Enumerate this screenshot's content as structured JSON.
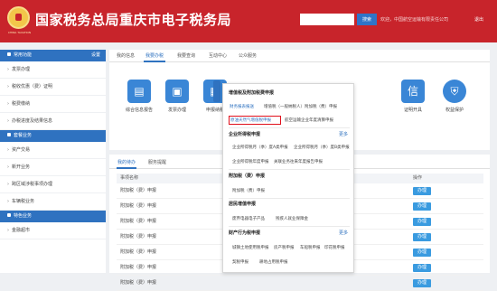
{
  "header": {
    "title": "国家税务总局重庆市电子税务局",
    "emblem_text": "CHINA TAXATION",
    "search_button": "搜索",
    "user_info": "欢迎，中国航空运输有限责任公司",
    "logout": "退出"
  },
  "sidebar": {
    "sections": [
      {
        "title": "常用功能",
        "right": "设置",
        "items": [
          "发票办理",
          "税收优惠（费）证明",
          "税费缴纳",
          "办税进度及结果信息"
        ]
      },
      {
        "title": "套餐业务",
        "items": [
          "资产交易",
          "新开业务",
          "跨区域涉税事项办理",
          "车辆税业务"
        ]
      },
      {
        "title": "特色业务",
        "items": [
          "金融超市"
        ]
      }
    ]
  },
  "main": {
    "tabs": [
      "我的信息",
      "我要办税",
      "我要查询",
      "互动中心",
      "公众服务"
    ],
    "quick_labels": [
      "综合信息报告",
      "发票办理",
      "申报纳税",
      "",
      "",
      "",
      "",
      "",
      "",
      "证明开具",
      "权益保护"
    ],
    "quick_glyphs": [
      "▤",
      "▣",
      "▦",
      "",
      "",
      "",
      "",
      "",
      "",
      "信",
      "⛨"
    ],
    "panel_tabs": [
      "我的待办",
      "服务提醒"
    ],
    "table": {
      "headers": [
        "事项名称",
        "操作"
      ],
      "rows": [
        {
          "name": "附加税（费）申报",
          "action": "办理"
        },
        {
          "name": "附加税（费）申报",
          "action": "办理"
        },
        {
          "name": "附加税（费）申报",
          "action": "办理"
        },
        {
          "name": "附加税（费）申报",
          "action": "办理"
        },
        {
          "name": "附加税（费）申报",
          "action": "办理"
        },
        {
          "name": "附加税（费）申报",
          "action": "办理"
        },
        {
          "name": "附加税（费）申报",
          "action": "办理"
        }
      ]
    }
  },
  "dropdown": {
    "sec1": "增值税及附加税费申报",
    "sec1_links": [
      "财务报表报送",
      "增值税（一般纳税人）附加税（费）申报",
      "原油天然气增值税申报",
      "航空运输企业年度清算申报"
    ],
    "sec2": "企业所得税申报",
    "sec2_more": "更多",
    "sec2_links": [
      "企业所得税月（季）度A类申报",
      "企业所得税月（季）度B类申报",
      "企业所得税年度申报",
      "关联业务往来年度报告申报"
    ],
    "sec3": "附加税（费）申报",
    "sec3_links": [
      "附加税（费）申报"
    ],
    "sec4": "居民增值申报",
    "sec4_links": [
      "废弃电器电子产品",
      "残疾人就业保障金"
    ],
    "sec5": "财产行为税申报",
    "sec5_more": "更多",
    "sec5_links": [
      "城镇土地使用税申报",
      "房产税申报",
      "车船税申报",
      "印花税申报",
      "契税申报",
      "耕地占用税申报"
    ]
  }
}
